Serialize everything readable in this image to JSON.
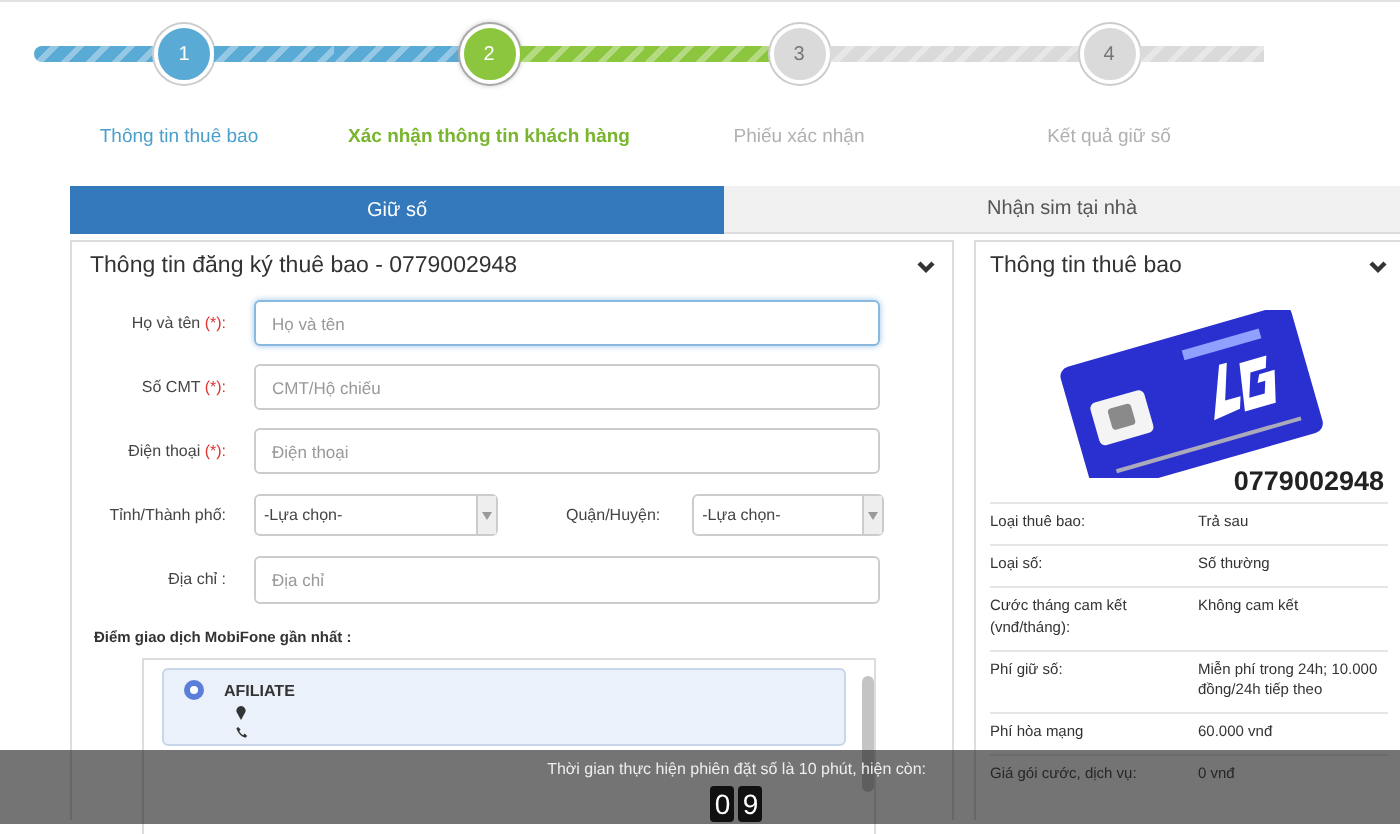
{
  "steps": [
    {
      "number": "1",
      "label": "Thông tin thuê bao",
      "completed": true,
      "selected": false
    },
    {
      "number": "2",
      "label": "Xác nhận thông tin khách hàng",
      "completed": false,
      "selected": true
    },
    {
      "number": "3",
      "label": "Phiếu xác nhận",
      "completed": false,
      "selected": false
    },
    {
      "number": "4",
      "label": "Kết quả giữ số",
      "completed": false,
      "selected": false
    }
  ],
  "tabs": [
    {
      "label": "Giữ số",
      "selected": true
    },
    {
      "label": "Nhận sim tại nhà",
      "selected": false
    }
  ],
  "form": {
    "title": "Thông tin đăng ký thuê bao - 0779002948",
    "rows": [
      {
        "kind": "input",
        "label": "Họ và tên",
        "mark": "(*):",
        "placeholder": "Họ và tên",
        "focused": true
      },
      {
        "kind": "input",
        "label": "Số CMT",
        "mark": "(*):",
        "placeholder": "CMT/Hộ chiếu",
        "focused": false
      },
      {
        "kind": "input",
        "label": "Điện thoại",
        "mark": "(*):",
        "placeholder": "Điện thoại",
        "focused": false
      },
      {
        "kind": "selects",
        "items": [
          {
            "label": "Tỉnh/Thành phố:",
            "value": "-Lựa chọn-"
          },
          {
            "label": "Quận/Huyện:",
            "value": "-Lựa chọn-"
          }
        ]
      },
      {
        "kind": "textarea",
        "label": "Địa chỉ :",
        "placeholder": "Địa chỉ"
      }
    ]
  },
  "stores": {
    "title": "Điểm giao dịch MobiFone gần nhất :",
    "items": [
      {
        "name": "AFILIATE",
        "selected": true
      }
    ]
  },
  "subscriber": {
    "title": "Thông tin thuê bao",
    "number": "0779002948",
    "rows": [
      {
        "label": "Loại thuê bao:",
        "value": "Trả sau"
      },
      {
        "label": "Loại số:",
        "value": "Số thường"
      },
      {
        "label": "Cước tháng cam kết (vnđ/tháng):",
        "value": "Không cam kết"
      },
      {
        "label": "Phí giữ số:",
        "value": "Miễn phí trong 24h; 10.000 đồng/24h tiếp theo"
      },
      {
        "label": "Phí hòa mạng",
        "value": "60.000 vnđ"
      },
      {
        "label": "Giá gói cước, dịch vụ:",
        "value": "0 vnđ"
      }
    ]
  },
  "timer": {
    "message": "Thời gian thực hiện phiên đặt số là 10 phút, hiện còn:",
    "digits": [
      "0",
      "9"
    ]
  }
}
